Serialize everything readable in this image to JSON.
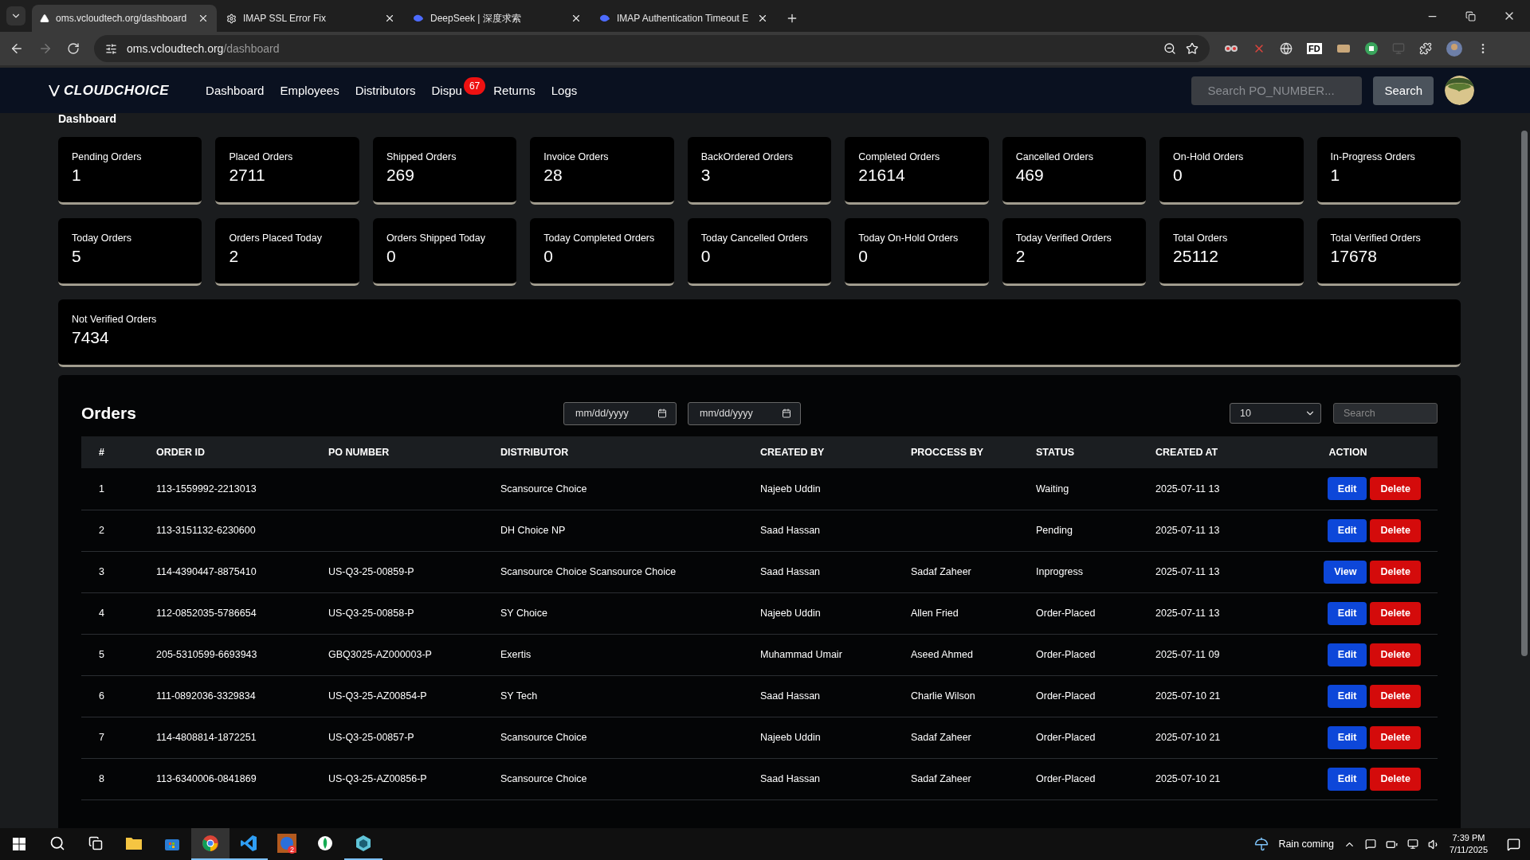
{
  "browser": {
    "tabs": [
      {
        "title": "oms.vcloudtech.org/dashboard",
        "kind": "triangle",
        "selected": true
      },
      {
        "title": "IMAP SSL Error Fix",
        "kind": "gear",
        "selected": false
      },
      {
        "title": "DeepSeek | 深度求索",
        "kind": "whale",
        "selected": false
      },
      {
        "title": "IMAP Authentication Timeout E",
        "kind": "whale",
        "selected": false
      }
    ],
    "url_host": "oms.vcloudtech.org",
    "url_path": "/dashboard",
    "extension_label": "FD"
  },
  "nav": {
    "logo": "CLOUDCHOICE",
    "items": [
      {
        "label": "Dashboard"
      },
      {
        "label": "Employees"
      },
      {
        "label": "Distributors"
      },
      {
        "label": "Dispu",
        "badge": "67"
      },
      {
        "label": "Returns"
      },
      {
        "label": "Logs"
      }
    ],
    "search": {
      "placeholder": "Search PO_NUMBER..."
    },
    "search_button": "Search"
  },
  "page_title": "Dashboard",
  "stats": [
    [
      {
        "label": "Pending Orders",
        "value": "1"
      },
      {
        "label": "Placed Orders",
        "value": "2711"
      },
      {
        "label": "Shipped Orders",
        "value": "269"
      },
      {
        "label": "Invoice Orders",
        "value": "28"
      },
      {
        "label": "BackOrdered Orders",
        "value": "3"
      },
      {
        "label": "Completed Orders",
        "value": "21614"
      },
      {
        "label": "Cancelled Orders",
        "value": "469"
      },
      {
        "label": "On-Hold Orders",
        "value": "0"
      },
      {
        "label": "In-Progress Orders",
        "value": "1"
      }
    ],
    [
      {
        "label": "Today Orders",
        "value": "5"
      },
      {
        "label": "Orders Placed Today",
        "value": "2"
      },
      {
        "label": "Orders Shipped Today",
        "value": "0"
      },
      {
        "label": "Today Completed Orders",
        "value": "0"
      },
      {
        "label": "Today Cancelled Orders",
        "value": "0"
      },
      {
        "label": "Today On-Hold Orders",
        "value": "0"
      },
      {
        "label": "Today Verified Orders",
        "value": "2"
      },
      {
        "label": "Total Orders",
        "value": "25112"
      },
      {
        "label": "Total Verified Orders",
        "value": "17678"
      }
    ]
  ],
  "wide_stat": {
    "label": "Not Verified Orders",
    "value": "7434"
  },
  "orders": {
    "title": "Orders",
    "date_from": {
      "placeholder": "mm/dd/yyyy"
    },
    "date_to": {
      "placeholder": "mm/dd/yyyy"
    },
    "page_size": "10",
    "search": {
      "placeholder": "Search"
    },
    "columns": [
      "#",
      "ORDER ID",
      "PO NUMBER",
      "DISTRIBUTOR",
      "CREATED BY",
      "PROCCESS BY",
      "STATUS",
      "CREATED AT",
      "ACTION"
    ],
    "rows": [
      {
        "cells": [
          "1",
          "113-1559992-2213013",
          "",
          "Scansource Choice",
          "Najeeb Uddin",
          "",
          "Waiting",
          "2025-07-11 13"
        ],
        "actions": [
          {
            "kind": "edit",
            "label": "Edit"
          },
          {
            "kind": "delete",
            "label": "Delete"
          }
        ]
      },
      {
        "cells": [
          "2",
          "113-3151132-6230600",
          "",
          "DH Choice NP",
          "Saad Hassan",
          "",
          "Pending",
          "2025-07-11 13"
        ],
        "actions": [
          {
            "kind": "edit",
            "label": "Edit"
          },
          {
            "kind": "delete",
            "label": "Delete"
          }
        ]
      },
      {
        "cells": [
          "3",
          "114-4390447-8875410",
          "US-Q3-25-00859-P",
          "Scansource Choice Scansource Choice",
          "Saad Hassan",
          "Sadaf Zaheer",
          "Inprogress",
          "2025-07-11 13"
        ],
        "actions": [
          {
            "kind": "view",
            "label": "View"
          },
          {
            "kind": "delete",
            "label": "Delete"
          }
        ]
      },
      {
        "cells": [
          "4",
          "112-0852035-5786654",
          "US-Q3-25-00858-P",
          "SY Choice",
          "Najeeb Uddin",
          "Allen Fried",
          "Order-Placed",
          "2025-07-11 13"
        ],
        "actions": [
          {
            "kind": "edit",
            "label": "Edit"
          },
          {
            "kind": "delete",
            "label": "Delete"
          }
        ]
      },
      {
        "cells": [
          "5",
          "205-5310599-6693943",
          "GBQ3025-AZ000003-P",
          "Exertis",
          "Muhammad Umair",
          "Aseed Ahmed",
          "Order-Placed",
          "2025-07-11 09"
        ],
        "actions": [
          {
            "kind": "edit",
            "label": "Edit"
          },
          {
            "kind": "delete",
            "label": "Delete"
          }
        ]
      },
      {
        "cells": [
          "6",
          "111-0892036-3329834",
          "US-Q3-25-AZ00854-P",
          "SY Tech",
          "Saad Hassan",
          "Charlie Wilson",
          "Order-Placed",
          "2025-07-10 21"
        ],
        "actions": [
          {
            "kind": "edit",
            "label": "Edit"
          },
          {
            "kind": "delete",
            "label": "Delete"
          }
        ]
      },
      {
        "cells": [
          "7",
          "114-4808814-1872251",
          "US-Q3-25-00857-P",
          "Scansource Choice",
          "Najeeb Uddin",
          "Sadaf Zaheer",
          "Order-Placed",
          "2025-07-10 21"
        ],
        "actions": [
          {
            "kind": "edit",
            "label": "Edit"
          },
          {
            "kind": "delete",
            "label": "Delete"
          }
        ]
      },
      {
        "cells": [
          "8",
          "113-6340006-0841869",
          "US-Q3-25-AZ00856-P",
          "Scansource Choice",
          "Saad Hassan",
          "Sadaf Zaheer",
          "Order-Placed",
          "2025-07-10 21"
        ],
        "actions": [
          {
            "kind": "edit",
            "label": "Edit"
          },
          {
            "kind": "delete",
            "label": "Delete"
          }
        ]
      }
    ]
  },
  "taskbar": {
    "apps": [
      {
        "kind": "folder",
        "open": false,
        "selected": false
      },
      {
        "kind": "store",
        "open": false,
        "selected": false
      },
      {
        "kind": "chrome",
        "open": true,
        "selected": true
      },
      {
        "kind": "code",
        "open": true,
        "selected": false
      },
      {
        "kind": "chat",
        "open": false,
        "selected": false,
        "badge": "2"
      },
      {
        "kind": "leaf",
        "open": false,
        "selected": false
      },
      {
        "kind": "cube",
        "open": true,
        "selected": false
      }
    ],
    "weather": "Rain coming",
    "time": "7:39 PM",
    "date": "7/11/2025"
  }
}
